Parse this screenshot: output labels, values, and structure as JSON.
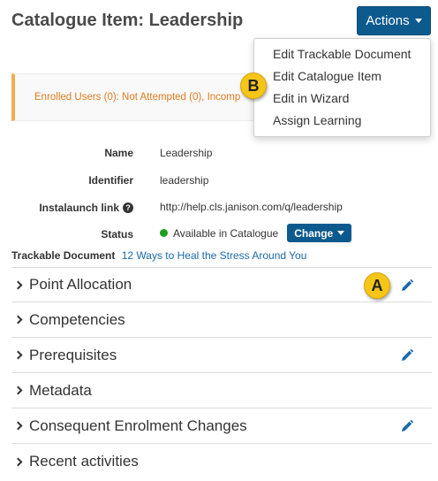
{
  "header": {
    "title": "Catalogue Item: Leadership",
    "actions_label": "Actions"
  },
  "alert": {
    "text": "Enrolled Users (0): Not Attempted (0), Incomp"
  },
  "dropdown": {
    "items": [
      {
        "label": "Edit Trackable Document"
      },
      {
        "label": "Edit Catalogue Item"
      },
      {
        "label": "Edit in Wizard"
      },
      {
        "label": "Assign Learning"
      }
    ]
  },
  "callouts": {
    "a": "A",
    "b": "B"
  },
  "details": {
    "name_label": "Name",
    "name_value": "Leadership",
    "identifier_label": "Identifier",
    "identifier_value": "leadership",
    "instalaunch_label": "Instalaunch link",
    "instalaunch_value": "http://help.cls.janison.com/q/leadership",
    "status_label": "Status",
    "status_value": "Available in Catalogue",
    "change_label": "Change",
    "help_icon_glyph": "?"
  },
  "trackable": {
    "label": "Trackable Document",
    "link": "12 Ways to Heal the Stress Around You"
  },
  "sections": [
    {
      "label": "Point Allocation",
      "editable": true
    },
    {
      "label": "Competencies",
      "editable": false
    },
    {
      "label": "Prerequisites",
      "editable": true
    },
    {
      "label": "Metadata",
      "editable": false
    },
    {
      "label": "Consequent Enrolment Changes",
      "editable": true
    },
    {
      "label": "Recent activities",
      "editable": false
    }
  ],
  "colors": {
    "primary": "#0d5a8e",
    "link": "#1a6aa8",
    "warning_border": "#f0ad4e",
    "warning_text": "#e07b20",
    "status_available": "#1e9e1e",
    "callout": "#f5c518"
  },
  "icons": {
    "edit": "pencil-icon",
    "expand": "chevron-right-icon",
    "help": "question-circle-icon",
    "dropdown": "caret-down-icon",
    "status": "status-dot-icon"
  }
}
